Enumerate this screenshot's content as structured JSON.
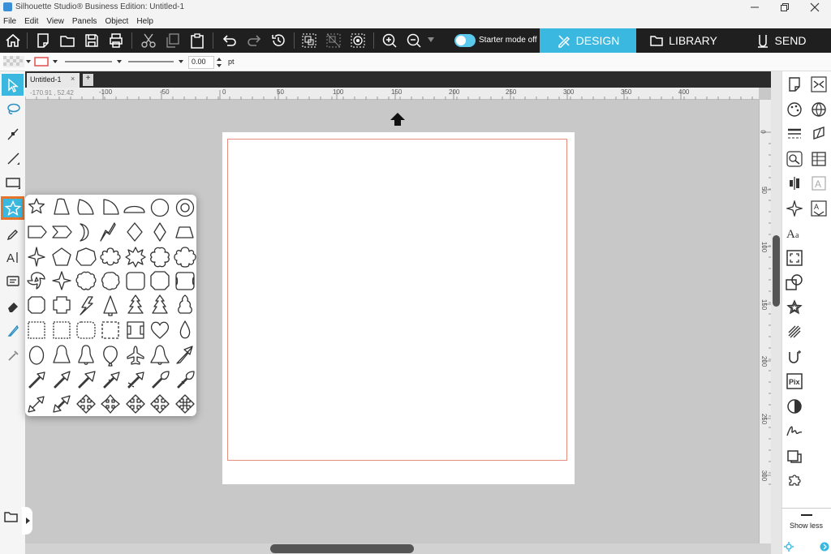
{
  "window": {
    "title": "Silhouette Studio® Business Edition: Untitled-1",
    "controls": [
      "minimize",
      "restore",
      "close"
    ]
  },
  "menu": [
    "File",
    "Edit",
    "View",
    "Panels",
    "Object",
    "Help"
  ],
  "toolbar": {
    "starter_mode_label": "Starter mode off",
    "tabs": [
      {
        "label": "DESIGN",
        "icon": "design-icon",
        "active": true
      },
      {
        "label": "LIBRARY",
        "icon": "folder-icon",
        "active": false
      },
      {
        "label": "SEND",
        "icon": "send-icon",
        "active": false
      }
    ],
    "accent_color": "#3ab8df"
  },
  "line_options": {
    "width_value": "0.00",
    "unit": "pt"
  },
  "document": {
    "tab_label": "Untitled-1",
    "close_glyph": "×",
    "add_glyph": "+"
  },
  "ruler": {
    "coord_readout": "-170.91 , 52.42",
    "h_ticks": [
      "-100",
      "-50",
      "0",
      "50",
      "100",
      "150",
      "200",
      "250",
      "300",
      "350",
      "400"
    ],
    "v_ticks": [
      "0",
      "50",
      "100",
      "150",
      "200",
      "250",
      "300"
    ]
  },
  "right_panel": {
    "show_less_label": "Show less"
  },
  "shapes_popup": {
    "shapes": [
      "star-shape",
      "triangle-shape",
      "quarter-circle-shape",
      "quarter-round-shape",
      "half-circle-shape",
      "circle-shape",
      "ring-shape",
      "pentagon-arrow-shape",
      "chevron-shape",
      "crescent-shape",
      "lightning-shape",
      "diamond-shape",
      "rhombus-shape",
      "trapezoid-shape",
      "cross-star-shape",
      "pentagon-shape",
      "heptagon-shape",
      "flower-6-shape",
      "star-8-shape",
      "flower-scallop-shape",
      "flower-8-shape",
      "swirl-star-shape",
      "star-4-shape",
      "scallop-circle-shape",
      "scallop-12-shape",
      "octagon-round-shape",
      "octagon-shape",
      "scallop-square-shape",
      "stamp-octagon-shape",
      "stamp-cross-shape",
      "lightning-bolt-shape",
      "cone-tree-shape",
      "pine-tree-shape",
      "fir-tree-shape",
      "round-tree-shape",
      "stamp-square-shape",
      "stamp-square-2-shape",
      "stamp-square-3-shape",
      "stamp-square-4-shape",
      "stamp-square-5-shape",
      "heart-shape",
      "drop-shape",
      "egg-shape",
      "bell-shape",
      "bell-2-shape",
      "balloon-shape",
      "airplane-shape",
      "bell-3-shape",
      "arrow-shape",
      "arrow-diag-1-shape",
      "arrow-diag-2-shape",
      "arrow-diag-3-shape",
      "arrow-diag-4-shape",
      "arrow-diag-5-shape",
      "arrow-diag-6-shape",
      "arrow-diag-7-shape",
      "double-arrow-1-shape",
      "double-arrow-2-shape",
      "four-way-arrow-1-shape",
      "four-way-arrow-2-shape",
      "four-way-arrow-3-shape",
      "four-way-arrow-4-shape",
      "four-way-arrow-5-shape"
    ]
  }
}
